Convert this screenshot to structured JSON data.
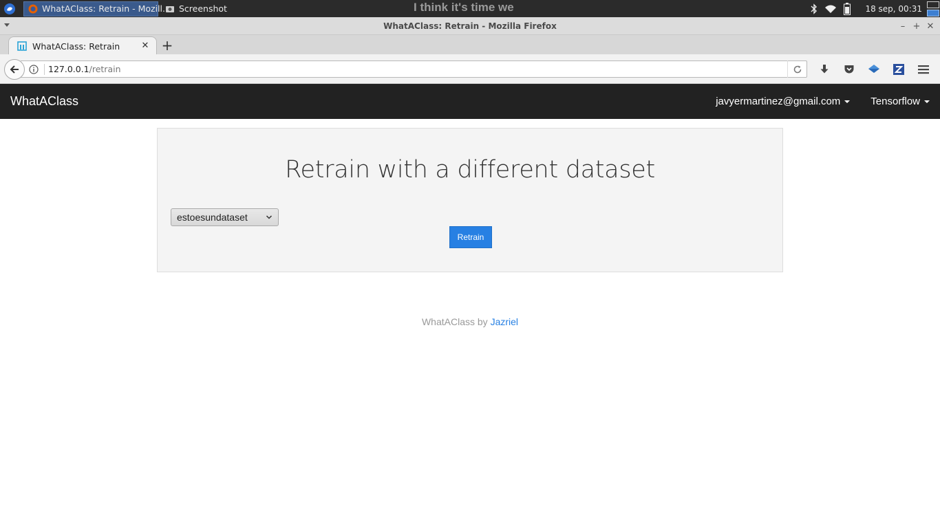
{
  "taskbar": {
    "tasks": [
      {
        "label": "WhatAClass: Retrain - Mozill...",
        "icon": "firefox-icon",
        "active": true
      },
      {
        "label": "Screenshot",
        "icon": "camera-icon",
        "active": false
      }
    ],
    "marquee": "I think it's time we",
    "clock": "18 sep, 00:31"
  },
  "window": {
    "title": "WhatAClass: Retrain - Mozilla Firefox",
    "controls": [
      "minimize",
      "maximize",
      "close"
    ]
  },
  "browser": {
    "tab": {
      "label": "WhatAClass: Retrain"
    },
    "url": {
      "host": "127.0.0.1",
      "path": "/retrain"
    }
  },
  "site": {
    "brand": "WhatAClass",
    "user_menu": "javyermartinez@gmail.com",
    "framework_menu": "Tensorflow"
  },
  "main": {
    "heading": "Retrain with a different dataset",
    "dataset_select": {
      "selected": "estoesundataset"
    },
    "retrain_button": "Retrain"
  },
  "footer": {
    "text": "WhatAClass by",
    "link": "Jazriel"
  },
  "colors": {
    "navbar_bg": "#222222",
    "accent": "#2780e3",
    "jumbotron_bg": "#f4f4f4"
  }
}
